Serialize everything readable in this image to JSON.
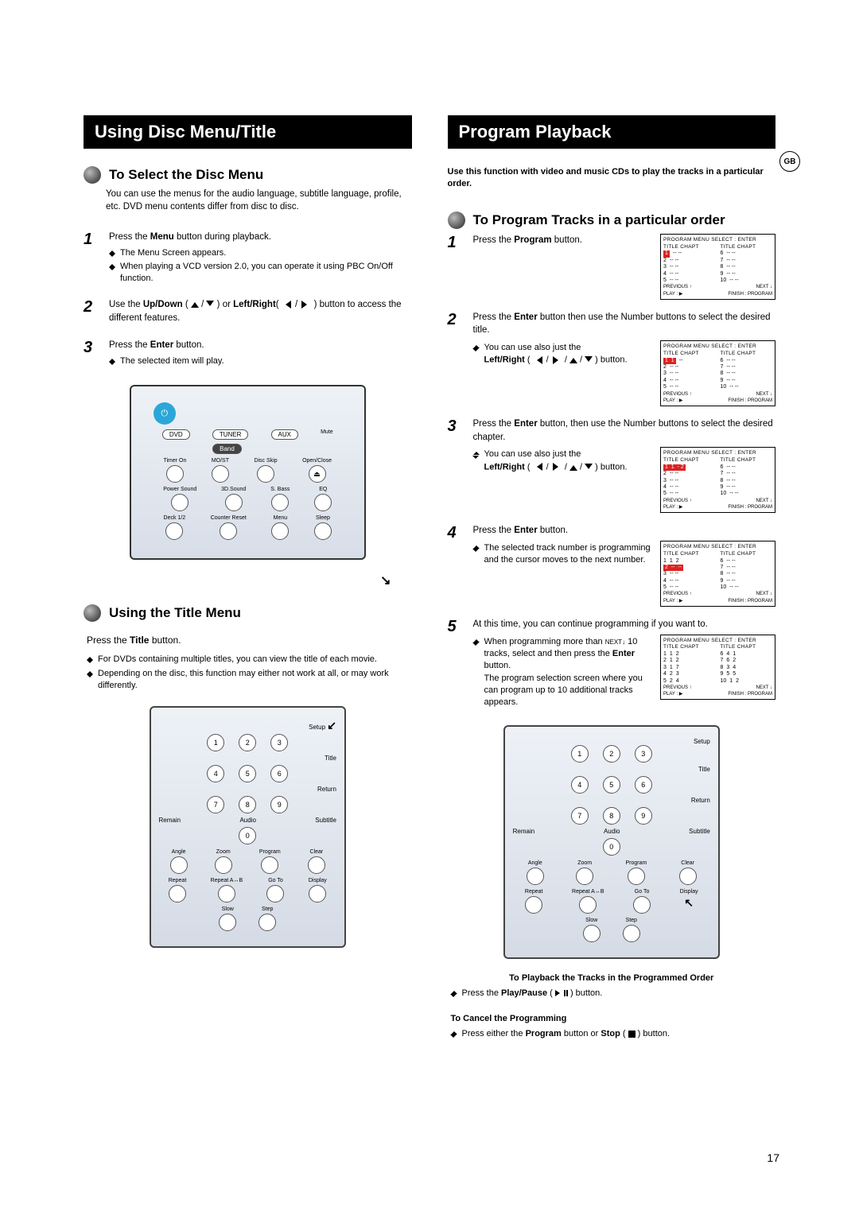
{
  "gb_label": "GB",
  "page_number": "17",
  "left": {
    "header": "Using Disc Menu/Title",
    "sect1": {
      "title": "To Select the Disc Menu",
      "intro": "You can use the menus for the audio language, subtitle language, profile, etc. DVD menu contents differ from disc to disc.",
      "step1": {
        "num": "1",
        "text": "Press the Menu button during playback.",
        "note1": "The Menu Screen appears.",
        "note2": "When playing a VCD version 2.0, you can operate it using PBC On/Off function."
      },
      "step2": {
        "num": "2",
        "text_a": "Use the ",
        "text_b": "Up/Down",
        "text_c": " ( ",
        "text_d": " / ",
        "text_e": " ) or ",
        "text_f": "Left/Right",
        "text_g": "( ",
        "text_h": " / ",
        "text_i": " ) button to access the different features."
      },
      "step3": {
        "num": "3",
        "text": "Press the Enter button.",
        "note1": "The selected item will play."
      }
    },
    "remote1": {
      "row1": [
        "DVD",
        "TUNER",
        "AUX",
        "Mute"
      ],
      "row1b": "Band",
      "row2": [
        "Timer On",
        "MO/ST",
        "Disc Skip",
        "Open/Close"
      ],
      "row3": [
        "Power Sound",
        "3D.Sound",
        "S. Bass",
        "EQ"
      ],
      "row4": [
        "Deck 1/2",
        "Counter Reset",
        "Menu",
        "Sleep"
      ],
      "arrow": "↘"
    },
    "sect2": {
      "title": "Using the Title Menu",
      "line1_a": "Press the ",
      "line1_b": "Title",
      "line1_c": " button.",
      "note1": "For DVDs containing multiple titles, you can view the title of each movie.",
      "note2": "Depending on the disc, this function may either not work at all, or may work differently."
    },
    "remote2_side": {
      "setup": "Setup",
      "title": "Title",
      "return": "Return",
      "remain": "Remain",
      "audio": "Audio",
      "subtitle": "Subtitle",
      "angle": "Angle",
      "zoom": "Zoom",
      "program": "Program",
      "clear": "Clear",
      "repeat": "Repeat",
      "repeat_ab": "Repeat A↔B",
      "goto": "Go To",
      "display": "Display",
      "slow": "Slow",
      "step": "Step"
    },
    "remote2_arrow": "↙"
  },
  "right": {
    "header": "Program Playback",
    "intro": "Use this function with video and music CDs to play the tracks in a particular order.",
    "sect_title": "To Program Tracks in a particular order",
    "step1": {
      "num": "1",
      "text": "Press the Program button."
    },
    "step2": {
      "num": "2",
      "text": "Press the Enter button then use the Number buttons to select the desired title.",
      "note_a": "You can use  also just the",
      "note_b": "Left/Right",
      "note_c": " ( ",
      "note_d": " / ",
      "note_e": " / ",
      "note_f": " / ",
      "note_g": " ) button."
    },
    "step3": {
      "num": "3",
      "text": "Press the Enter button, then use the Number buttons to select the desired chapter.",
      "note_a": "You can use  also just the",
      "note_b": "Left/Right",
      "note_c": " ( ",
      "note_d": " / ",
      "note_e": " / ",
      "note_f": " / ",
      "note_g": " ) button."
    },
    "step4": {
      "num": "4",
      "text": "Press the Enter button.",
      "note1": "The selected track number is programming and the cursor moves to the next number."
    },
    "step5": {
      "num": "5",
      "text": "At this time, you can continue programming if you want to.",
      "note1_a": "When programming more than ",
      "note1_b": "NEXT↓",
      "note1_c": " 10 tracks, select and then press the ",
      "note1_d": "Enter",
      "note1_e": " button.",
      "note2": "The program selection screen where you can program up to 10 additional tracks appears."
    },
    "menu": {
      "hdr": "PROGRAM MENU   SELECT : ENTER",
      "col_hdr": "TITLE CHAPT",
      "prev": "PREVIOUS ↑",
      "next": "NEXT ↓",
      "play": "PLAY : ▶",
      "finish": "FINISH : PROGRAM",
      "rows_blank_left": [
        [
          "1",
          "--",
          "--"
        ],
        [
          "2",
          "--",
          "--"
        ],
        [
          "3",
          "--",
          "--"
        ],
        [
          "4",
          "--",
          "--"
        ],
        [
          "5",
          "--",
          "--"
        ]
      ],
      "rows_blank_right": [
        [
          "6",
          "--",
          "--"
        ],
        [
          "7",
          "--",
          "--"
        ],
        [
          "8",
          "--",
          "--"
        ],
        [
          "9",
          "--",
          "--"
        ],
        [
          "10",
          "--",
          "--"
        ]
      ],
      "rows_t1_left": [
        [
          "1",
          "1",
          "--"
        ],
        [
          "2",
          "--",
          "--"
        ],
        [
          "3",
          "--",
          "--"
        ],
        [
          "4",
          "--",
          "--"
        ],
        [
          "5",
          "--",
          "--"
        ]
      ],
      "rows_t1c_left": [
        [
          "1",
          "1",
          "- 2"
        ],
        [
          "2",
          "--",
          "--"
        ],
        [
          "3",
          "--",
          "--"
        ],
        [
          "4",
          "--",
          "--"
        ],
        [
          "5",
          "--",
          "--"
        ]
      ],
      "rows_t12_left": [
        [
          "1",
          "1",
          "2"
        ],
        [
          "2",
          "--",
          "--"
        ],
        [
          "3",
          "--",
          "--"
        ],
        [
          "4",
          "--",
          "--"
        ],
        [
          "5",
          "--",
          "--"
        ]
      ],
      "rows_full_left": [
        [
          "1",
          "1",
          "2"
        ],
        [
          "2",
          "1",
          "2"
        ],
        [
          "3",
          "1",
          "7"
        ],
        [
          "4",
          "2",
          "3"
        ],
        [
          "5",
          "2",
          "4"
        ]
      ],
      "rows_full_right": [
        [
          "6",
          "4",
          "1"
        ],
        [
          "7",
          "6",
          "2"
        ],
        [
          "8",
          "3",
          "4"
        ],
        [
          "9",
          "5",
          "5"
        ],
        [
          "10",
          "1",
          "2"
        ]
      ]
    },
    "callout1": "To Playback the Tracks in the Programmed Order",
    "callout1_note_a": "Press the ",
    "callout1_note_b": "Play/Pause",
    "callout1_note_c": " ( ",
    "callout1_note_d": " ) button.",
    "callout2": "To Cancel the Programming",
    "callout2_note_a": "Press either the ",
    "callout2_note_b": "Program",
    "callout2_note_c": " button or ",
    "callout2_note_d": "Stop",
    "callout2_note_e": " ( ",
    "callout2_note_f": " ) button."
  }
}
